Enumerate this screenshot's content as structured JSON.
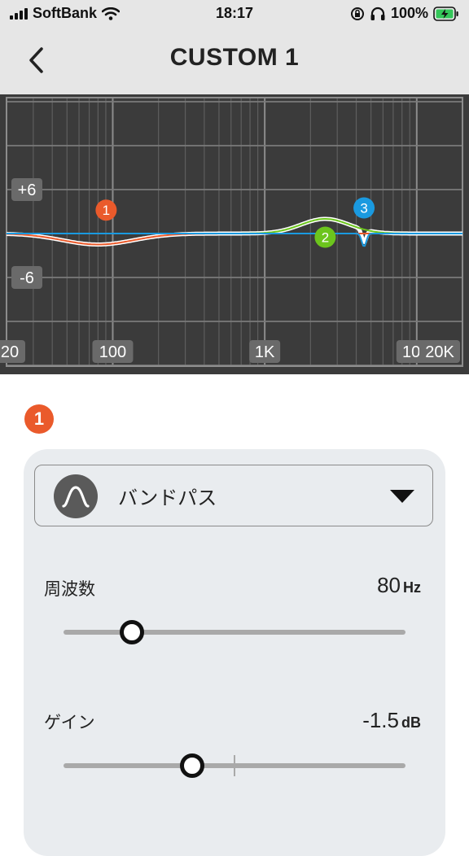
{
  "status_bar": {
    "carrier": "SoftBank",
    "time": "18:17",
    "battery": "100%"
  },
  "header": {
    "title": "CUSTOM 1",
    "back_icon": "chevron-left-icon"
  },
  "eq_graph": {
    "gain_labels": [
      "+6",
      "-6"
    ],
    "freq_labels": [
      "20",
      "100",
      "1K",
      "10K",
      "20K"
    ],
    "bands": [
      {
        "id": "1",
        "color": "#ea5a2b",
        "freq_hz": 80,
        "gain_db": -1.5
      },
      {
        "id": "2",
        "color": "#6cc51d",
        "freq_hz": 2500,
        "gain_db": 2
      },
      {
        "id": "3",
        "color": "#1a9ae0",
        "freq_hz": 4500,
        "gain_db": -1.8
      }
    ],
    "colors": {
      "background": "#3b3b3b",
      "grid": "#8a8a8a",
      "total_curve": "#ffffff"
    }
  },
  "band_panel": {
    "selected_band": "1",
    "filter_type": "バンドパス",
    "filter_icon": "bandpass-curve-icon",
    "frequency": {
      "label": "周波数",
      "value": "80",
      "unit": "Hz",
      "slider_fraction": 0.2
    },
    "gain": {
      "label": "ゲイン",
      "value": "-1.5",
      "unit": "dB",
      "slider_fraction": 0.375
    }
  }
}
